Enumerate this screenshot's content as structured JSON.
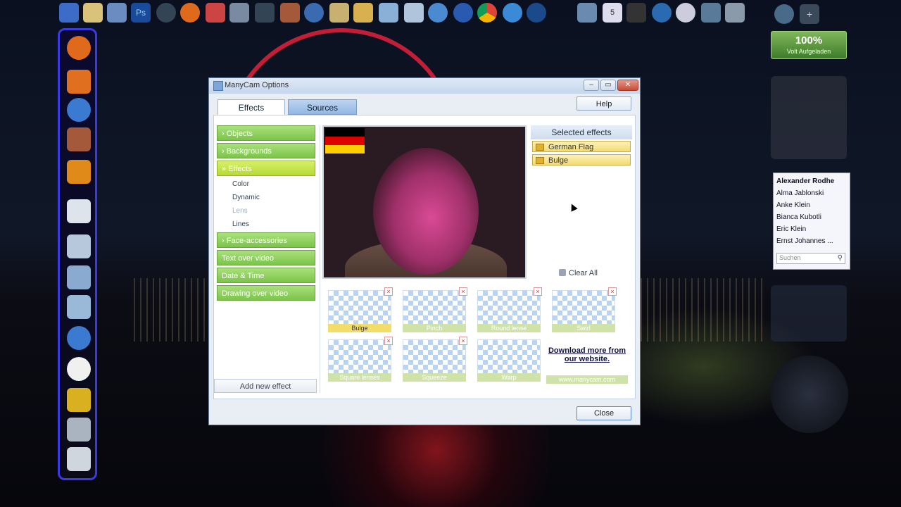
{
  "desktop": {
    "battery_gadget": {
      "percent": "100%",
      "status": "Volt Aufgeladen"
    },
    "contacts": {
      "items": [
        "Alexander Rodhe",
        "Alma Jablonski",
        "Anke Klein",
        "Bianca Kubotli",
        "Eric Klein",
        "Ernst Johannes ..."
      ],
      "search_placeholder": "Suchen"
    },
    "top_icons": [
      "start-icon",
      "folder-icon",
      "computer-icon",
      "photoshop-icon",
      "globe-icon",
      "firefox-icon",
      "arrow-icon",
      "tools-icon",
      "media-icon",
      "avatar-icon",
      "explorer-icon",
      "pen-icon",
      "edit-icon",
      "network-icon",
      "mail-icon",
      "internet-icon",
      "orbit-icon",
      "chrome-icon",
      "ie-icon",
      "download-icon",
      "settings-icon",
      "calendar-icon",
      "graduation-icon",
      "windows-icon",
      "clock-icon",
      "search-icon",
      "printer-icon"
    ],
    "dock_icons": [
      "firefox-icon",
      "media-player-icon",
      "safari-icon",
      "avatar-icon",
      "burst-icon",
      "document-icon",
      "folder-icon",
      "folder-icon",
      "folder-icon",
      "globe-icon",
      "clock-icon",
      "star-icon",
      "tool-icon",
      "recycle-icon"
    ]
  },
  "dialog": {
    "title": "ManyCam Options",
    "tabs": [
      {
        "label": "Effects",
        "active": true
      },
      {
        "label": "Sources",
        "active": false
      }
    ],
    "help_label": "Help",
    "close_label": "Close",
    "categories": [
      {
        "label": "› Objects",
        "open": false
      },
      {
        "label": "› Backgrounds",
        "open": false
      },
      {
        "label": "» Effects",
        "open": true
      },
      {
        "label": "› Face-accessories",
        "open": false
      },
      {
        "label": "Text over video",
        "open": false
      },
      {
        "label": "Date & Time",
        "open": false
      },
      {
        "label": "Drawing over video",
        "open": false
      }
    ],
    "subcategories": [
      {
        "label": "Color",
        "dim": false
      },
      {
        "label": "Dynamic",
        "dim": false
      },
      {
        "label": "Lens",
        "dim": true
      },
      {
        "label": "Lines",
        "dim": false
      }
    ],
    "add_new_effect_label": "Add new effect",
    "selected_effects": {
      "title": "Selected effects",
      "items": [
        "German Flag",
        "Bulge"
      ],
      "clear_all_label": "Clear All"
    },
    "effects_grid": [
      {
        "label": "Bulge",
        "selected": true
      },
      {
        "label": "Pinch",
        "selected": false
      },
      {
        "label": "Round lense",
        "selected": false
      },
      {
        "label": "Swirl",
        "selected": false
      },
      {
        "label": "Square lenses",
        "selected": false
      },
      {
        "label": "Squeeze",
        "selected": false
      },
      {
        "label": "Warp",
        "selected": false
      }
    ],
    "download_more": "Download more from our website.",
    "download_url": "www.manycam.com",
    "flag_colors": [
      "#000000",
      "#dd0000",
      "#ffce00"
    ]
  }
}
